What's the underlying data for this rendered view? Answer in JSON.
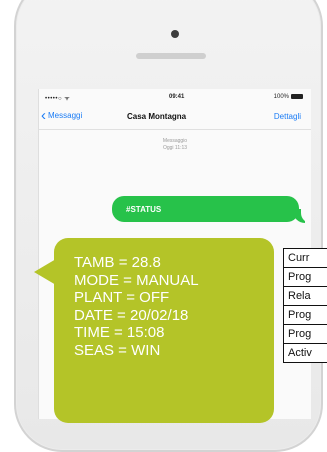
{
  "phone": {
    "statusbar": {
      "carrier": "•••••○ ᯤ",
      "time": "09:41",
      "battery": "100%"
    },
    "nav": {
      "back_label": "Messaggi",
      "title": "Casa Montagna",
      "details_label": "Dettagli"
    },
    "meta": {
      "line1": "Messaggio",
      "line2": "Oggi 11:13"
    },
    "sent_message": "#STATUS"
  },
  "reply": {
    "lines": [
      "TAMB = 28.8",
      "MODE = MANUAL",
      "PLANT = OFF",
      "DATE = 20/02/18",
      "TIME = 15:08",
      "SEAS = WIN"
    ]
  },
  "table": {
    "rows": [
      "Curr",
      "Prog",
      "Rela",
      "Prog",
      "Prog",
      "Activ"
    ]
  },
  "colors": {
    "imessage_green": "#27c24a",
    "callout_green": "#b4c428",
    "link_blue": "#1b7cf5"
  }
}
